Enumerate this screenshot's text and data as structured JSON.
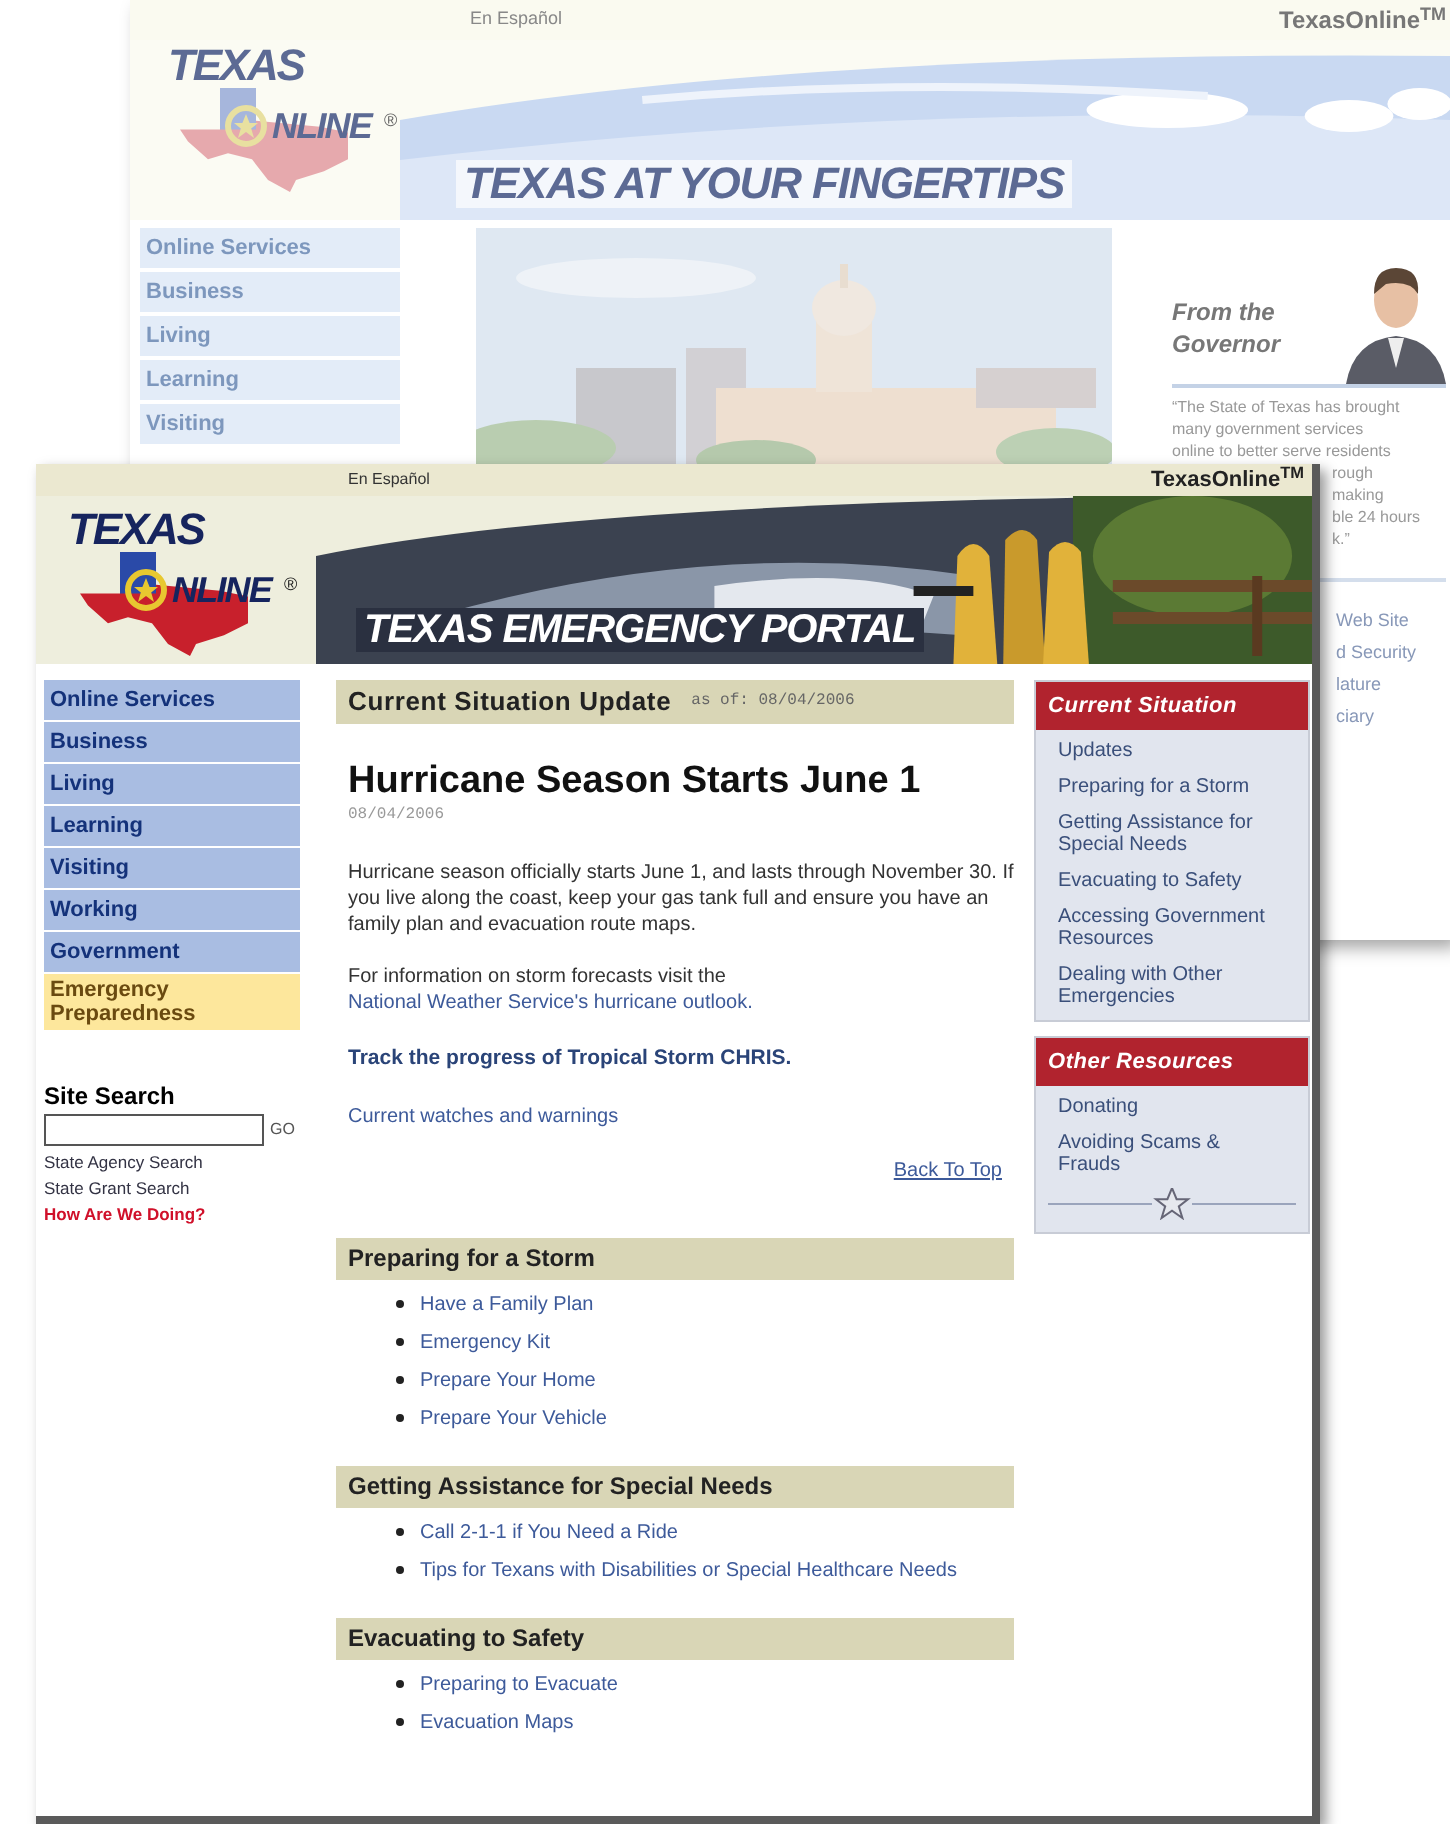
{
  "back_page": {
    "top_bar": {
      "language_link": "En Español",
      "brand": "TexasOnline$^{TM}$"
    },
    "logo": {
      "line1": "TEXAS",
      "line2": "NLINE",
      "mark": "®"
    },
    "banner_title": "TEXAS AT YOUR FINGERTIPS",
    "nav": [
      {
        "label": "Online Services"
      },
      {
        "label": "Business"
      },
      {
        "label": "Living"
      },
      {
        "label": "Learning"
      },
      {
        "label": "Visiting"
      }
    ],
    "governor": {
      "heading_lines": [
        "From the",
        "Governor"
      ],
      "quote_lines": [
        "“The State of Texas has brought",
        "many government services",
        "online to better serve residents"
      ],
      "quote_fragments": [
        "rough",
        "making",
        "ble 24 hours",
        "k.”"
      ]
    },
    "link_fragments": [
      "Web Site",
      "d Security",
      "lature",
      "ciary"
    ]
  },
  "front_page": {
    "top_bar": {
      "language_link": "En Español",
      "brand": "TexasOnline$^{TM}$"
    },
    "logo": {
      "line1": "TEXAS",
      "line2": "NLINE",
      "mark": "®"
    },
    "banner_title": "TEXAS EMERGENCY PORTAL",
    "nav": [
      {
        "label": "Online Services",
        "selected": false
      },
      {
        "label": "Business",
        "selected": false
      },
      {
        "label": "Living",
        "selected": false
      },
      {
        "label": "Learning",
        "selected": false
      },
      {
        "label": "Visiting",
        "selected": false
      },
      {
        "label": "Working",
        "selected": false
      },
      {
        "label": "Government",
        "selected": false
      },
      {
        "label": "Emergency Preparedness",
        "selected": true
      }
    ],
    "site_search": {
      "label": "Site Search",
      "button": "GO",
      "links": [
        {
          "label": "State Agency Search",
          "kind": "plain"
        },
        {
          "label": "State Grant Search",
          "kind": "plain"
        },
        {
          "label": "How Are We Doing?",
          "kind": "alert"
        }
      ]
    },
    "update_bar": {
      "title": "Current Situation Update",
      "as_of": "as of: 08/04/2006"
    },
    "article": {
      "title": "Hurricane Season Starts June 1",
      "date": "08/04/2006",
      "paragraph": "Hurricane season officially starts June 1, and lasts through November 30. If you live along the coast, keep your gas tank full and ensure you have an family plan and evacuation route maps.",
      "forecast_text": "For information on storm forecasts visit the",
      "forecast_link": "National Weather Service's hurricane outlook.",
      "track_link": "Track the progress of Tropical Storm CHRIS.",
      "watches_link": "Current watches and warnings",
      "back_to_top": "Back To Top"
    },
    "sections": [
      {
        "title": "Preparing for a Storm",
        "items": [
          "Have a Family Plan",
          "Emergency Kit",
          "Prepare Your Home",
          "Prepare Your Vehicle"
        ]
      },
      {
        "title": "Getting Assistance for Special Needs",
        "items": [
          "Call 2-1-1 if You Need a Ride",
          "Tips for Texans with Disabilities or Special Healthcare Needs"
        ]
      },
      {
        "title": "Evacuating to Safety",
        "items": [
          "Preparing to Evacuate",
          "Evacuation Maps"
        ]
      }
    ],
    "sidebar_panels": [
      {
        "title": "Current Situation",
        "items": [
          "Updates",
          "Preparing for a Storm",
          "Getting Assistance for Special Needs",
          "Evacuating to Safety",
          "Accessing Government Resources",
          "Dealing with Other Emergencies"
        ],
        "star_divider": false
      },
      {
        "title": "Other Resources",
        "items": [
          "Donating",
          "Avoiding Scams & Frauds"
        ],
        "star_divider": true
      }
    ]
  }
}
